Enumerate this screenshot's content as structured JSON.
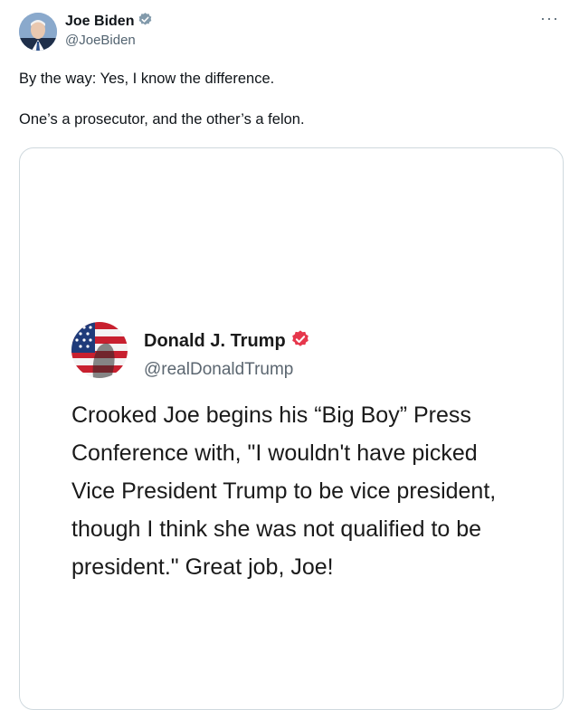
{
  "tweet": {
    "author_name": "Joe Biden",
    "author_handle": "@JoeBiden",
    "more_label": "···",
    "text_line1": "By the way: Yes, I know the difference.",
    "text_line2": "One’s a prosecutor, and the other’s a felon."
  },
  "quoted": {
    "author_name": "Donald J. Trump",
    "author_handle": "@realDonaldTrump",
    "text": "Crooked Joe begins his “Big Boy” Press Conference with, \"I wouldn't have picked Vice President Trump to be vice president, though I think she was not qualified to be president.\" Great job, Joe!"
  },
  "colors": {
    "verified_blue": "#829aab",
    "truth_badge": "#e6374c"
  },
  "icons": [
    "verified-badge-icon",
    "truth-verified-icon",
    "more-options-icon"
  ]
}
